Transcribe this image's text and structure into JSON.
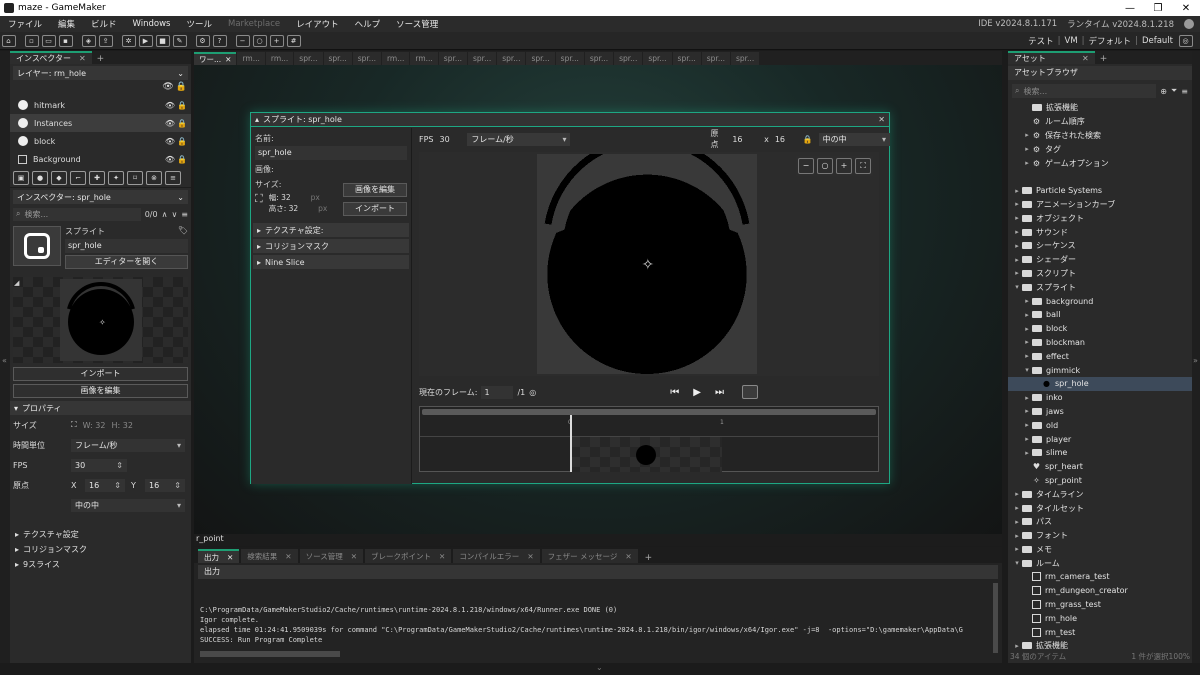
{
  "window": {
    "title": "maze - GameMaker",
    "minimize": "—",
    "maximize": "❐",
    "close": "✕"
  },
  "menu": {
    "items": [
      "ファイル",
      "編集",
      "ビルド",
      "Windows",
      "ツール",
      "Marketplace",
      "レイアウト",
      "ヘルプ",
      "ソース管理"
    ],
    "ide_version": "IDE v2024.8.1.171",
    "runtime_version": "ランタイム v2024.8.1.218"
  },
  "toolbar": {
    "target_test": "テスト",
    "target_vm": "VM",
    "target_default": "デフォルト",
    "target_config": "Default"
  },
  "room_inspector": {
    "tab": "インスペクター",
    "layer_dropdown": "レイヤー: rm_hole",
    "layers": [
      {
        "name": "hitmark",
        "type": "object"
      },
      {
        "name": "Instances",
        "type": "object"
      },
      {
        "name": "block",
        "type": "object"
      },
      {
        "name": "Background",
        "type": "background"
      }
    ]
  },
  "sprite_inspector": {
    "dropdown": "インスペクター: spr_hole",
    "search_placeholder": "検索...",
    "search_count": "0/0",
    "section_label": "スプライト",
    "sprite_name": "spr_hole",
    "open_editor": "エディターを開く",
    "import_button": "インポート",
    "edit_image_button": "画像を編集",
    "properties_header": "プロパティ",
    "size_label": "サイズ",
    "width_text": "W: 32",
    "height_text": "H: 32",
    "time_unit_label": "時間単位",
    "time_unit_value": "フレーム/秒",
    "fps_label": "FPS",
    "fps_value": "30",
    "origin_label": "原点",
    "origin_x_label": "X",
    "origin_x": "16",
    "origin_y_label": "Y",
    "origin_y": "16",
    "origin_preset": "中の中",
    "collapsed": [
      "テクスチャ設定",
      "コリジョンマスク",
      "9スライス"
    ]
  },
  "workspace_tabs": [
    "ワー...",
    "rm...",
    "rm...",
    "spr...",
    "spr...",
    "spr...",
    "rm...",
    "rm...",
    "spr...",
    "spr...",
    "spr...",
    "spr...",
    "spr...",
    "spr...",
    "spr...",
    "spr...",
    "spr...",
    "spr...",
    "spr..."
  ],
  "sprite_editor": {
    "title": "スプライト: spr_hole",
    "name_label": "名前:",
    "name_value": "spr_hole",
    "image_label": "画像:",
    "size_label": "サイズ:",
    "width_label": "幅:",
    "width_value": "32",
    "height_label": "高さ:",
    "height_value": "32",
    "unit": "px",
    "edit_image_button": "画像を編集",
    "import_button": "インポート",
    "sections": [
      "テクスチャ設定:",
      "コリジョンマスク",
      "Nine Slice"
    ],
    "fps_label": "FPS",
    "fps_value": "30",
    "time_unit": "フレーム/秒",
    "origin_label": "原点",
    "origin_x": "16",
    "origin_times": "x",
    "origin_y": "16",
    "origin_preset": "中の中",
    "current_frame_label": "現在のフレーム:",
    "current_frame": "1",
    "frame_total": "/1",
    "ruler_start": "0",
    "ruler_end": "1"
  },
  "room_label": "r_point",
  "output": {
    "tabs": [
      "出力",
      "検索結果",
      "ソース管理",
      "ブレークポイント",
      "コンパイルエラー",
      "フェザー メッセージ"
    ],
    "header": "出力",
    "lines": [
      "C:\\ProgramData/GameMakerStudio2/Cache/runtimes\\runtime-2024.8.1.218/windows/x64/Runner.exe DONE (0)",
      "Igor complete.",
      "elapsed time 01:24:41.9509039s for command \"C:\\ProgramData/GameMakerStudio2/Cache/runtimes\\runtime-2024.8.1.218/bin/igor/windows/x64/Igor.exe\" -j=8  -options=\"D:\\gamemaker\\AppData\\G",
      "SUCCESS: Run Program Complete"
    ]
  },
  "asset_browser": {
    "tab": "アセット",
    "header": "アセットブラウザ",
    "search_placeholder": "検索...",
    "tree": [
      {
        "label": "拡張機能",
        "level": 1,
        "kind": "folder",
        "arrow": ""
      },
      {
        "label": "ルーム順序",
        "level": 1,
        "kind": "special",
        "arrow": ""
      },
      {
        "label": "保存された検索",
        "level": 1,
        "kind": "special",
        "arrow": "▸"
      },
      {
        "label": "タグ",
        "level": 1,
        "kind": "special",
        "arrow": "▸"
      },
      {
        "label": "ゲームオプション",
        "level": 1,
        "kind": "special",
        "arrow": "▸"
      },
      {
        "label": "",
        "level": 0,
        "kind": "spacer",
        "arrow": ""
      },
      {
        "label": "Particle Systems",
        "level": 0,
        "kind": "folder",
        "arrow": "▸"
      },
      {
        "label": "アニメーションカーブ",
        "level": 0,
        "kind": "folder",
        "arrow": "▸"
      },
      {
        "label": "オブジェクト",
        "level": 0,
        "kind": "folder",
        "arrow": "▸"
      },
      {
        "label": "サウンド",
        "level": 0,
        "kind": "folder",
        "arrow": "▸"
      },
      {
        "label": "シーケンス",
        "level": 0,
        "kind": "folder",
        "arrow": "▸"
      },
      {
        "label": "シェーダー",
        "level": 0,
        "kind": "folder",
        "arrow": "▸"
      },
      {
        "label": "スクリプト",
        "level": 0,
        "kind": "folder",
        "arrow": "▸"
      },
      {
        "label": "スプライト",
        "level": 0,
        "kind": "folder",
        "arrow": "▾"
      },
      {
        "label": "background",
        "level": 1,
        "kind": "folder",
        "arrow": "▸"
      },
      {
        "label": "ball",
        "level": 1,
        "kind": "folder",
        "arrow": "▸"
      },
      {
        "label": "block",
        "level": 1,
        "kind": "folder",
        "arrow": "▸"
      },
      {
        "label": "blockman",
        "level": 1,
        "kind": "folder",
        "arrow": "▸"
      },
      {
        "label": "effect",
        "level": 1,
        "kind": "folder",
        "arrow": "▸"
      },
      {
        "label": "gimmick",
        "level": 1,
        "kind": "folder",
        "arrow": "▾"
      },
      {
        "label": "spr_hole",
        "level": 2,
        "kind": "sprite-dark",
        "arrow": "",
        "selected": true
      },
      {
        "label": "inko",
        "level": 1,
        "kind": "folder",
        "arrow": "▸"
      },
      {
        "label": "jaws",
        "level": 1,
        "kind": "folder",
        "arrow": "▸"
      },
      {
        "label": "old",
        "level": 1,
        "kind": "folder",
        "arrow": "▸"
      },
      {
        "label": "player",
        "level": 1,
        "kind": "folder",
        "arrow": "▸"
      },
      {
        "label": "slime",
        "level": 1,
        "kind": "folder",
        "arrow": "▸"
      },
      {
        "label": "spr_heart",
        "level": 1,
        "kind": "heart",
        "arrow": ""
      },
      {
        "label": "spr_point",
        "level": 1,
        "kind": "sprite-light",
        "arrow": ""
      },
      {
        "label": "タイムライン",
        "level": 0,
        "kind": "folder",
        "arrow": "▸"
      },
      {
        "label": "タイルセット",
        "level": 0,
        "kind": "folder",
        "arrow": "▸"
      },
      {
        "label": "パス",
        "level": 0,
        "kind": "folder",
        "arrow": "▸"
      },
      {
        "label": "フォント",
        "level": 0,
        "kind": "folder",
        "arrow": "▸"
      },
      {
        "label": "メモ",
        "level": 0,
        "kind": "folder",
        "arrow": "▸"
      },
      {
        "label": "ルーム",
        "level": 0,
        "kind": "folder",
        "arrow": "▾"
      },
      {
        "label": "rm_camera_test",
        "level": 1,
        "kind": "room",
        "arrow": ""
      },
      {
        "label": "rm_dungeon_creator",
        "level": 1,
        "kind": "room",
        "arrow": ""
      },
      {
        "label": "rm_grass_test",
        "level": 1,
        "kind": "room",
        "arrow": ""
      },
      {
        "label": "rm_hole",
        "level": 1,
        "kind": "room",
        "arrow": ""
      },
      {
        "label": "rm_test",
        "level": 1,
        "kind": "room",
        "arrow": ""
      },
      {
        "label": "拡張機能",
        "level": 0,
        "kind": "folder",
        "arrow": "▸"
      }
    ],
    "footer_count": "34 個のアイテム",
    "footer_selected": "1 件が選択",
    "footer_zoom": "100%"
  },
  "colors": {
    "accent": "#1e9e73",
    "panel": "#2a2a2a",
    "selection": "#3d4a5a"
  }
}
